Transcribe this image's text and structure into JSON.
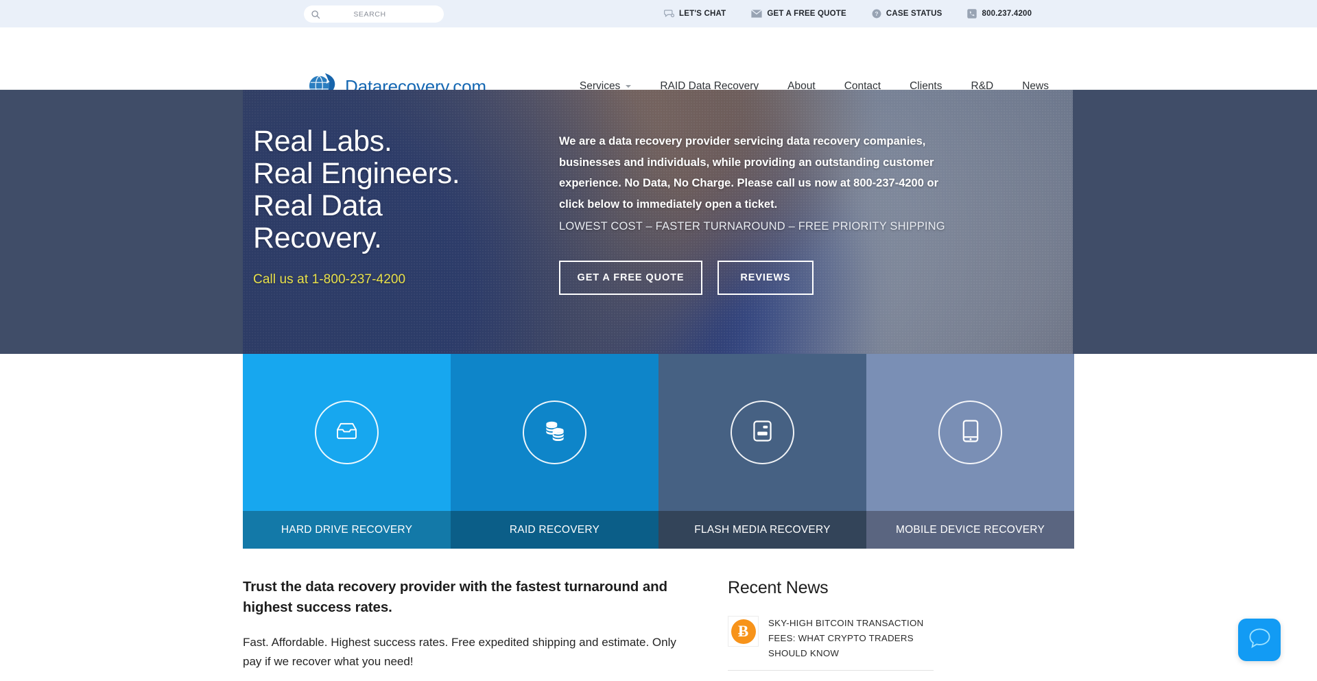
{
  "utility": {
    "search": {
      "placeholder": "SEARCH",
      "value": "",
      "icon": "search-icon"
    },
    "links": [
      {
        "label": "LET'S CHAT",
        "icon": "chat-bubble-icon"
      },
      {
        "label": "GET A FREE QUOTE",
        "icon": "envelope-icon"
      },
      {
        "label": "CASE STATUS",
        "icon": "question-circle-icon"
      },
      {
        "label": "800.237.4200",
        "icon": "phone-icon"
      }
    ]
  },
  "header": {
    "logo_text": "Datarecovery.com",
    "logo_icon": "globe-data-logo-icon",
    "nav": [
      {
        "label": "Services",
        "has_caret": true
      },
      {
        "label": "RAID Data Recovery",
        "has_caret": false
      },
      {
        "label": "About",
        "has_caret": false
      },
      {
        "label": "Contact",
        "has_caret": false
      },
      {
        "label": "Clients",
        "has_caret": false
      },
      {
        "label": "R&D",
        "has_caret": false
      },
      {
        "label": "News",
        "has_caret": false
      }
    ]
  },
  "hero": {
    "title_lines": [
      "Real Labs.",
      "Real Engineers.",
      "Real Data",
      "Recovery."
    ],
    "phone_line": "Call us at 1-800-237-4200",
    "paragraph": "We are a data recovery provider servicing data recovery companies, businesses and individuals, while providing an outstanding customer experience. No Data, No Charge. Please call us now at 800-237-4200 or click below to immediately open a ticket.",
    "subline": "LOWEST COST – FASTER TURNAROUND – FREE PRIORITY SHIPPING",
    "primary_button": "GET A FREE QUOTE",
    "secondary_button": "REVIEWS",
    "background_color": "#404d68",
    "phone_color": "#e8e04a"
  },
  "tiles": [
    {
      "label": "HARD DRIVE RECOVERY",
      "icon": "hard-drive-tray-icon",
      "top_color": "#17a7ef",
      "bottom_color": "#1379a8"
    },
    {
      "label": "RAID RECOVERY",
      "icon": "stacked-disks-icon",
      "top_color": "#0e85c9",
      "bottom_color": "#0b5e88"
    },
    {
      "label": "FLASH MEDIA RECOVERY",
      "icon": "flash-card-icon",
      "top_color": "#466183",
      "bottom_color": "#334459"
    },
    {
      "label": "MOBILE DEVICE RECOVERY",
      "icon": "mobile-phone-icon",
      "top_color": "#7a8fb5",
      "bottom_color": "#5a6580"
    }
  ],
  "content": {
    "heading": "Trust the data recovery provider with the fastest turnaround and highest success rates.",
    "paragraph": "Fast. Affordable. Highest success rates. Free expedited shipping and estimate. Only pay if we recover what you need!"
  },
  "sidebar": {
    "heading": "Recent News",
    "items": [
      {
        "title": "SKY-HIGH BITCOIN TRANSACTION FEES: WHAT CRYPTO TRADERS SHOULD KNOW",
        "thumb_icon": "bitcoin-icon",
        "thumb_glyph": "Ƀ",
        "thumb_color": "#f7931a"
      }
    ]
  },
  "chat_widget": {
    "icon": "chat-bubble-icon",
    "color": "#129bf4"
  }
}
